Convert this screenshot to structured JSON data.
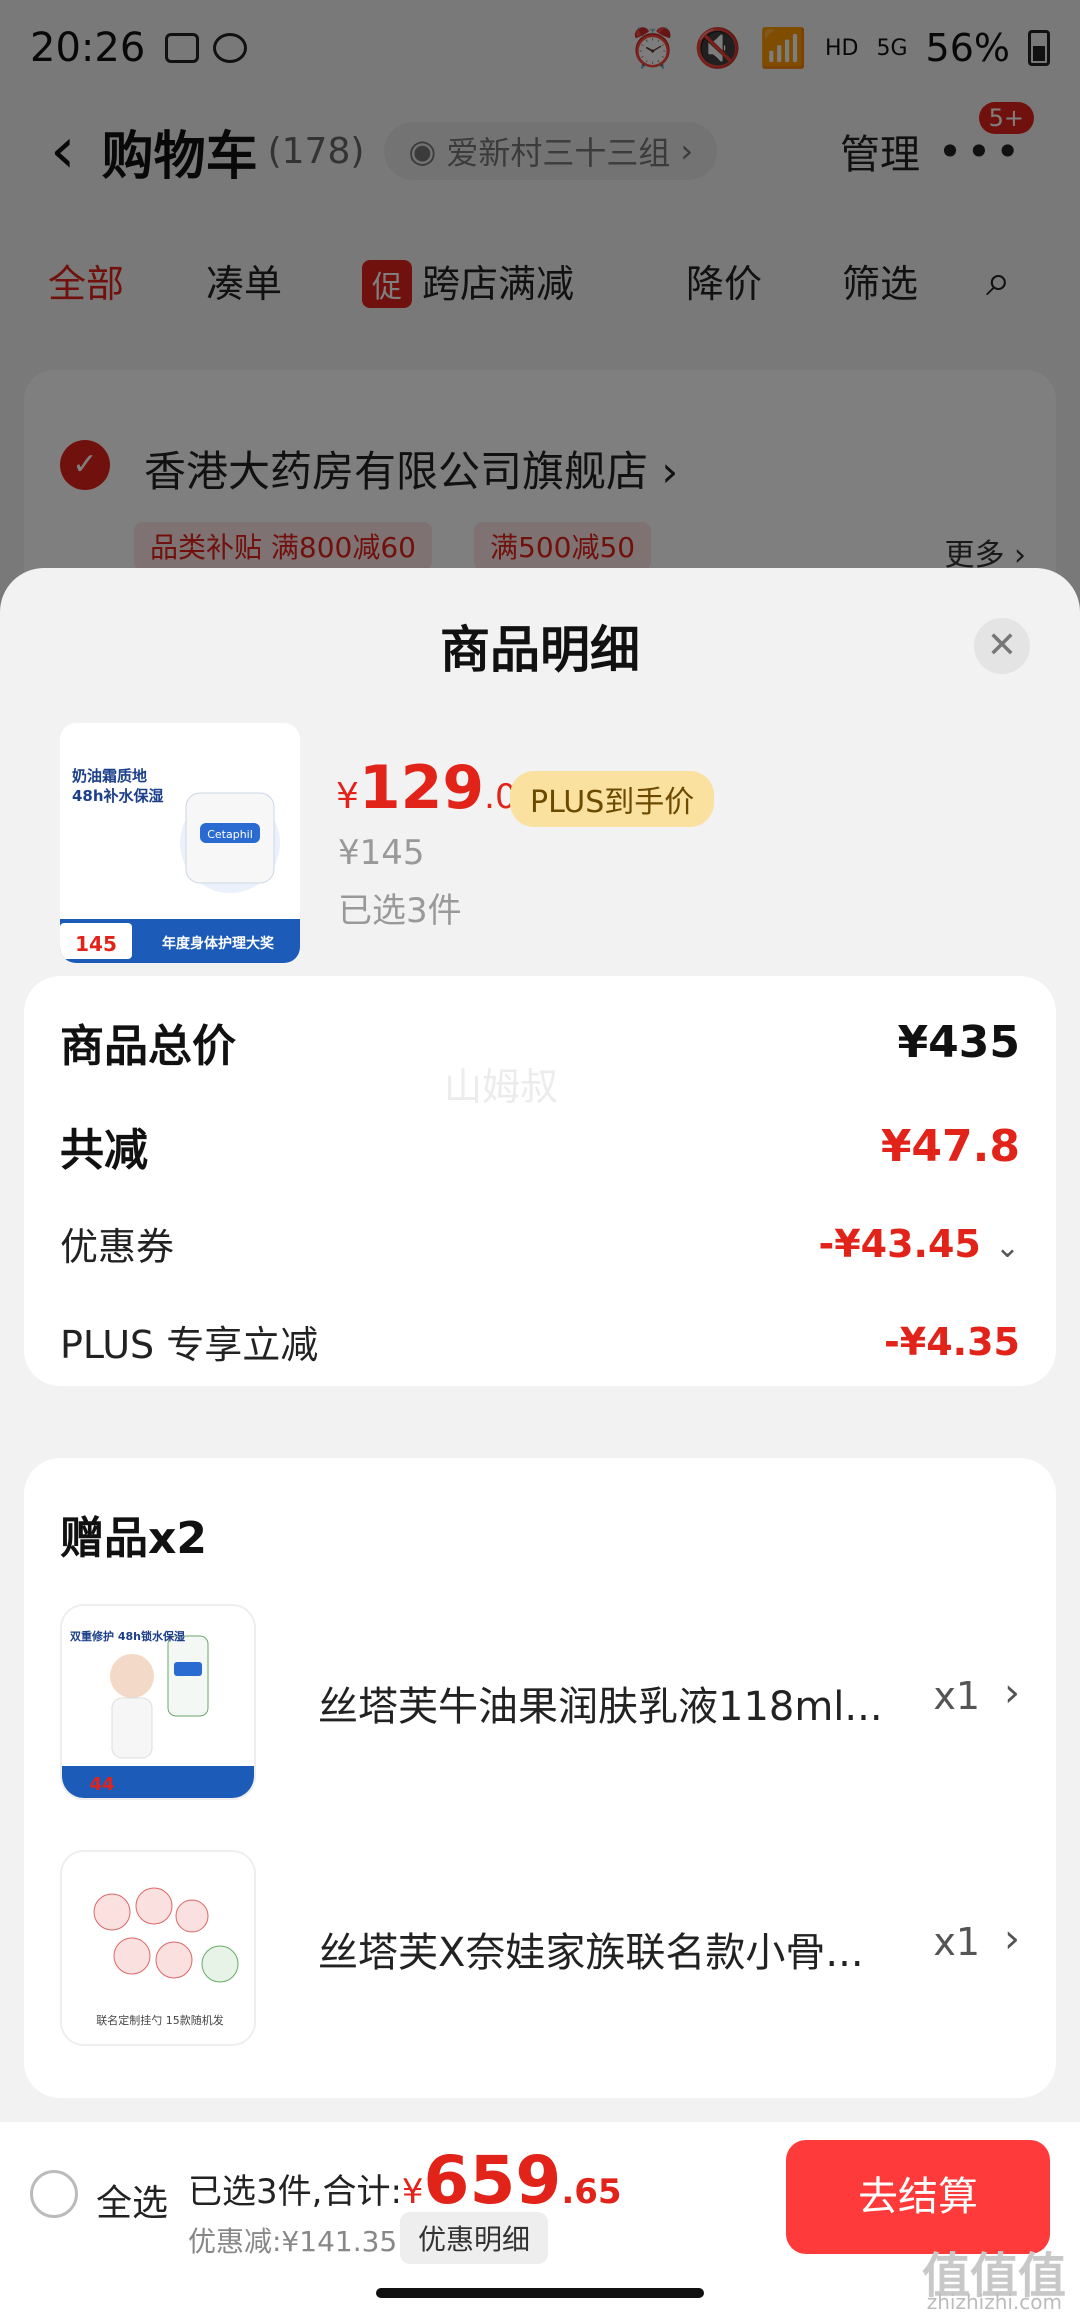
{
  "status_bar": {
    "time": "20:26",
    "network_label": "HD",
    "signal_label": "5G",
    "battery": "56%"
  },
  "nav": {
    "back_icon": "chevron-left-icon",
    "title": "购物车",
    "count": "(178)",
    "address": "爱新村三十三组",
    "manage": "管理",
    "more_badge": "5+"
  },
  "tabs": {
    "all": "全部",
    "bundle": "凑单",
    "promo_tag": "促",
    "cross_store": "跨店满减",
    "price_drop": "降价",
    "filter": "筛选"
  },
  "store": {
    "name": "香港大药房有限公司旗舰店",
    "coupons": [
      "品类补贴 满800减60",
      "满500减50"
    ],
    "more": "更多"
  },
  "sheet": {
    "title": "商品明细",
    "product": {
      "price_symbol": "¥",
      "price_int": "129",
      "price_dec": ".06",
      "plus_label": "PLUS到手价",
      "original_price": "¥145",
      "selected": "已选3件",
      "image_texts": {
        "headline": "奶油霜质地",
        "headline2": "48h补水保湿",
        "brand": "Cetaphil",
        "price_tag": "145",
        "banner": "年度身体护理大奖"
      }
    },
    "summary": {
      "total_label": "商品总价",
      "total_value": "¥435",
      "reduce_label": "共减",
      "reduce_value": "¥47.8",
      "coupon_label": "优惠券",
      "coupon_value": "-¥43.45",
      "plus_label": "PLUS 专享立减",
      "plus_value": "-¥4.35",
      "watermark": "山姆叔"
    },
    "gifts": {
      "title": "赠品x2",
      "items": [
        {
          "name": "丝塔芙牛油果润肤乳液118ml...",
          "qty": "x1",
          "img_tag": "44",
          "img_text": "双重修护 48h锁水保湿"
        },
        {
          "name": "丝塔芙X奈娃家族联名款小骨...",
          "qty": "x1",
          "img_text": "联名定制挂勺 15款随机发"
        }
      ]
    }
  },
  "bottom_bar": {
    "select_all": "全选",
    "summary_prefix": "已选3件,合计:",
    "total_symbol": "¥",
    "total_int": "659",
    "total_dec": ".65",
    "discount": "优惠减:¥141.35",
    "detail_button": "优惠明细",
    "checkout": "去结算"
  },
  "watermark": {
    "site_main": "值值值",
    "site_sub": "zhizhizhi.com"
  },
  "colors": {
    "accent_red": "#e2231a",
    "checkout_red": "#ff3a3a",
    "plus_gold": "#fbe1a0"
  }
}
